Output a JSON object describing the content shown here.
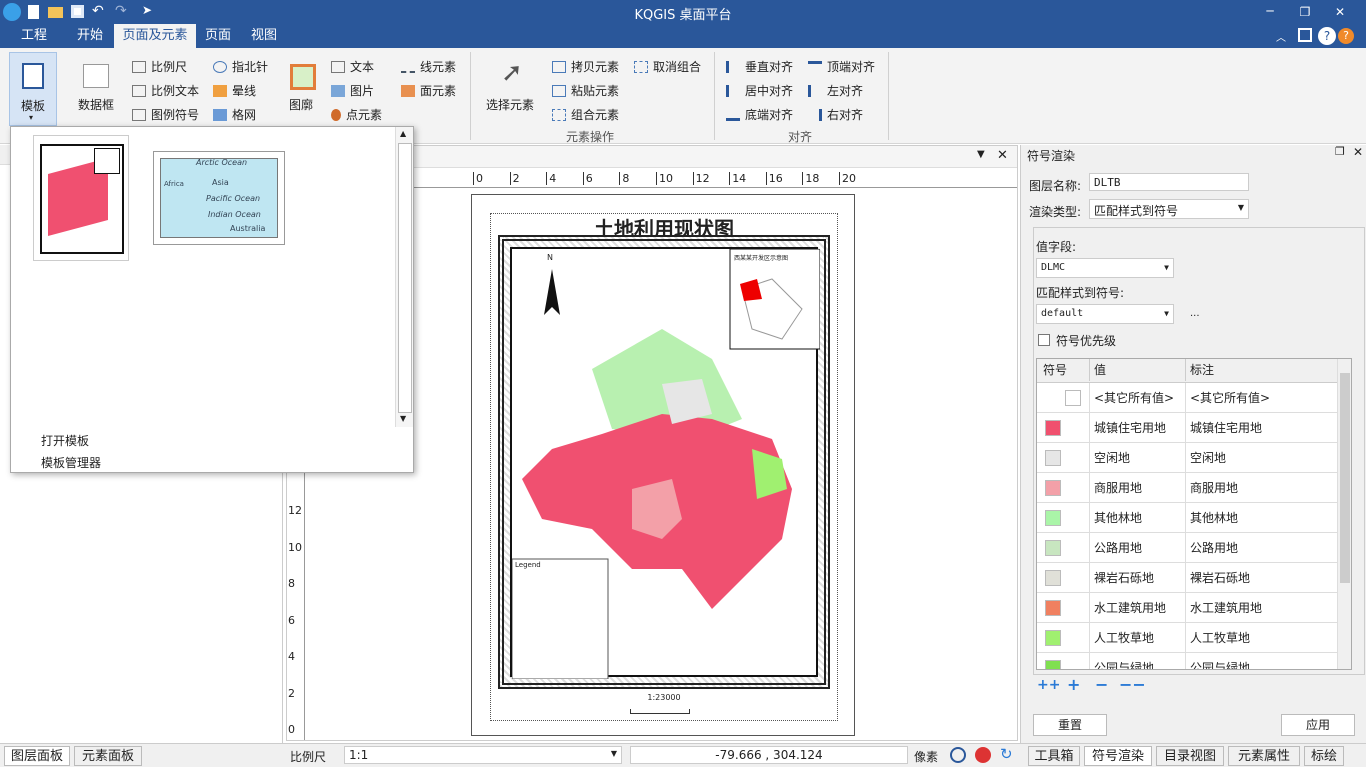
{
  "app": {
    "title": "KQGIS 桌面平台"
  },
  "menu": [
    {
      "label": "工程"
    },
    {
      "label": "开始"
    },
    {
      "label": "页面及元素"
    },
    {
      "label": "页面"
    },
    {
      "label": "视图"
    }
  ],
  "ribbon": {
    "template": "模板",
    "dataframe": "数据框",
    "scale_bar": "比例尺",
    "scale_text": "比例文本",
    "legend_symbol": "图例符号",
    "north_arrow": "指北针",
    "halo": "晕线",
    "grid": "格网",
    "legend": "图廓",
    "text": "文本",
    "picture": "图片",
    "point_element": "点元素",
    "line_element": "线元素",
    "area_element": "面元素",
    "select_element": "选择元素",
    "copy_element": "拷贝元素",
    "paste_element": "粘贴元素",
    "group_element": "组合元素",
    "ungroup": "取消组合",
    "group_label_elem": "元素操作",
    "vcenter": "垂直对齐",
    "hcenter": "居中对齐",
    "bottom_align": "底端对齐",
    "top_align": "顶端对齐",
    "left_align": "左对齐",
    "right_align": "右对齐",
    "group_label_align": "对齐"
  },
  "dropdown": {
    "open_template": "打开模板",
    "template_manager": "模板管理器",
    "thumb2_labels": [
      "Arctic Ocean",
      "Asia",
      "Pacific Ocean",
      "Indian Ocean",
      "Australia",
      "Africa"
    ]
  },
  "map": {
    "title": "土地利用现状图",
    "north": "N",
    "inset_title": "西某某开发区示意图",
    "legend_title": "Legend",
    "scale": "1:23000",
    "ruler_top": [
      "0",
      "2",
      "4",
      "6",
      "8",
      "10",
      "12",
      "14",
      "16",
      "18",
      "20"
    ],
    "ruler_left": [
      "12",
      "10",
      "8",
      "6",
      "4",
      "2",
      "0"
    ]
  },
  "right_panel": {
    "title": "符号渲染",
    "layer_name_label": "图层名称:",
    "layer_name": "DLTB",
    "render_type_label": "渲染类型:",
    "render_type": "匹配样式到符号",
    "value_field_label": "值字段:",
    "value_field": "DLMC",
    "match_label": "匹配样式到符号:",
    "match_value": "default",
    "ellipsis": "...",
    "priority_label": "符号优先级",
    "columns": [
      "符号",
      "值",
      "标注"
    ],
    "rows": [
      {
        "value": "<其它所有值>",
        "label": "<其它所有值>",
        "color": "#ffffff"
      },
      {
        "value": "城镇住宅用地",
        "label": "城镇住宅用地",
        "color": "#f0506e"
      },
      {
        "value": "空闲地",
        "label": "空闲地",
        "color": "#e6e6e6"
      },
      {
        "value": "商服用地",
        "label": "商服用地",
        "color": "#f3a0a8"
      },
      {
        "value": "其他林地",
        "label": "其他林地",
        "color": "#aaf5a8"
      },
      {
        "value": "公路用地",
        "label": "公路用地",
        "color": "#c8e6c0"
      },
      {
        "value": "裸岩石砾地",
        "label": "裸岩石砾地",
        "color": "#e0e0d8"
      },
      {
        "value": "水工建筑用地",
        "label": "水工建筑用地",
        "color": "#f08060"
      },
      {
        "value": "人工牧草地",
        "label": "人工牧草地",
        "color": "#a0f070"
      },
      {
        "value": "公园与绿地",
        "label": "公园与绿地",
        "color": "#80e050"
      }
    ],
    "ops": [
      "++",
      "+",
      "−",
      "−−"
    ],
    "reset": "重置",
    "apply": "应用"
  },
  "status": {
    "scale_label": "比例尺",
    "scale_value": "1:1",
    "coords": "-79.666 , 304.124",
    "unit": "像素"
  },
  "left_tabs": [
    "图层面板",
    "元素面板"
  ],
  "right_tabs": [
    "工具箱",
    "符号渲染",
    "目录视图",
    "元素属性",
    "标绘"
  ]
}
